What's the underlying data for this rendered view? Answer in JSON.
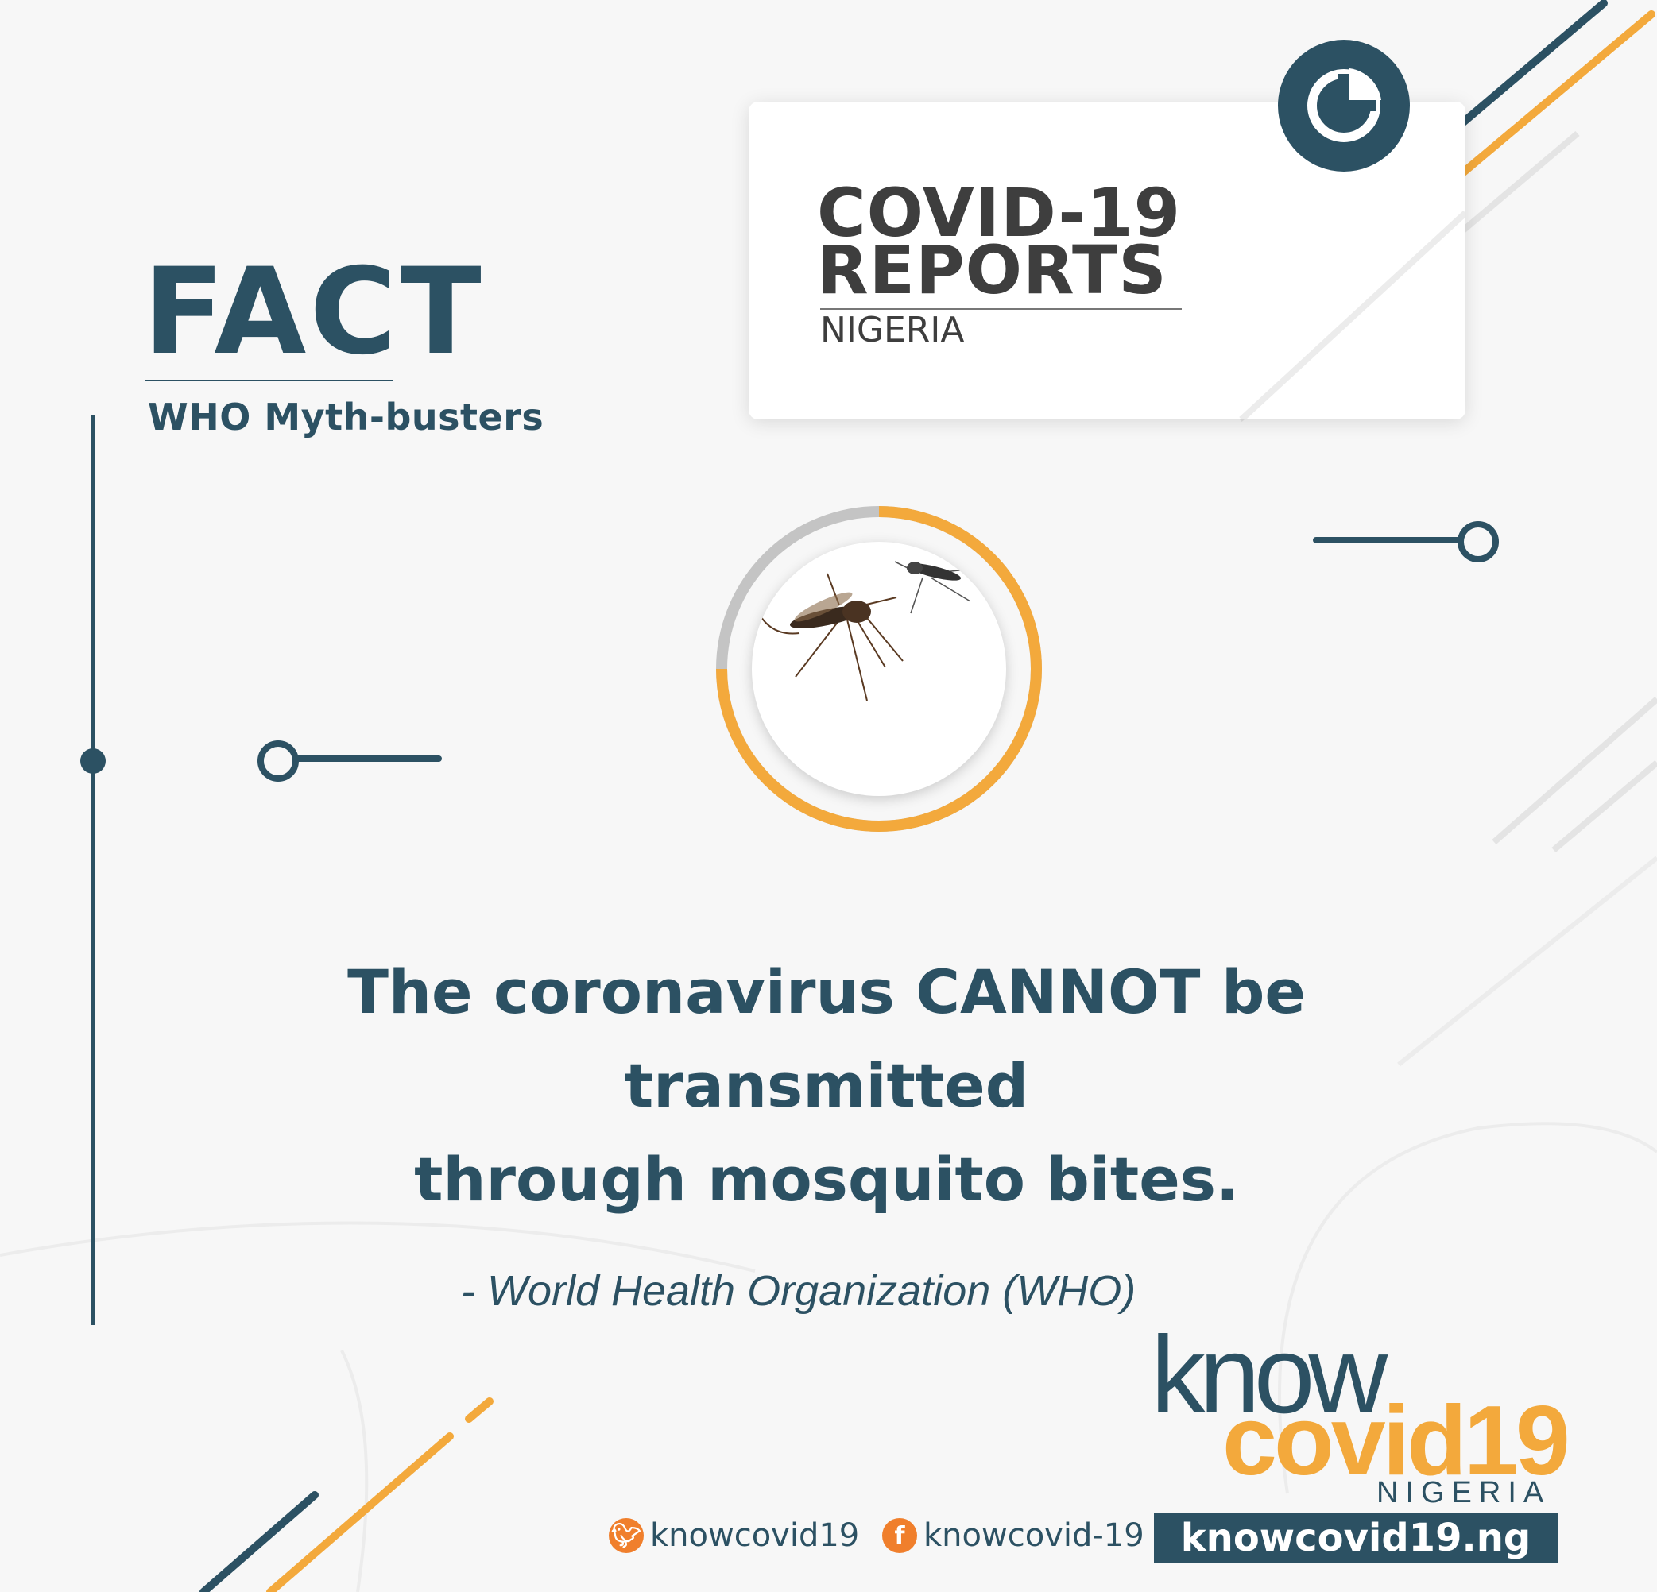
{
  "fact": {
    "title": "FACT",
    "subtitle": "WHO Myth-busters"
  },
  "report": {
    "title_line1": "COVID-19",
    "title_line2": "REPORTS",
    "country": "NIGERIA"
  },
  "statement": {
    "line1": "The coronavirus CANNOT be transmitted",
    "line2": "through mosquito bites."
  },
  "attribution": "- World Health Organization (WHO)",
  "logo": {
    "know": "know",
    "covid": "covid19",
    "country": "NIGERIA"
  },
  "social": {
    "twitter_handle": "knowcovid19",
    "facebook_handle": "knowcovid-19",
    "website": "knowcovid19.ng"
  },
  "colors": {
    "navy": "#2c5163",
    "orange": "#f3a93c",
    "grey": "#c4c4c4"
  }
}
